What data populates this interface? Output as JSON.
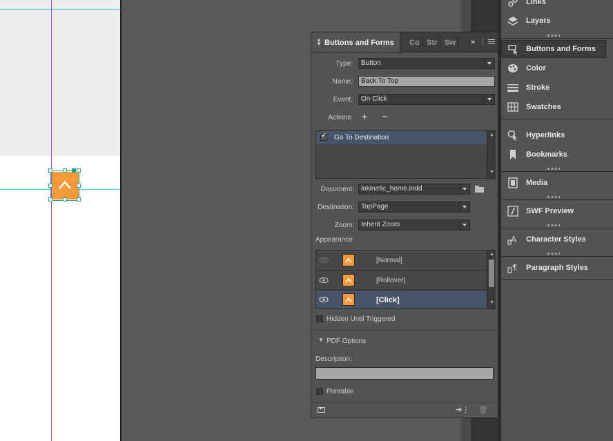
{
  "panel": {
    "tabs": {
      "active": "Buttons and Forms",
      "others": [
        "Co",
        "Str",
        "Sw"
      ]
    },
    "type": {
      "label": "Type:",
      "value": "Button"
    },
    "name": {
      "label": "Name:",
      "value": "Back To Top"
    },
    "event": {
      "label": "Event:",
      "value": "On Click"
    },
    "actions": {
      "label": "Actions:",
      "add": "+",
      "remove": "−",
      "items": [
        {
          "label": "Go To Destination",
          "checked": true
        }
      ]
    },
    "document": {
      "label": "Document:",
      "value": "iokinetic_home.indd"
    },
    "destination": {
      "label": "Destination:",
      "value": "TopPage"
    },
    "zoom": {
      "label": "Zoom:",
      "value": "Inherit Zoom"
    },
    "appearance": {
      "heading": "Appearance",
      "states": [
        {
          "label": "[Normal]",
          "selected": false
        },
        {
          "label": "[Rollover]",
          "selected": false
        },
        {
          "label": "[Click]",
          "selected": true
        }
      ]
    },
    "hidden_until_triggered": {
      "label": "Hidden Until Triggered",
      "checked": false
    },
    "pdf_options": {
      "heading": "PDF Options",
      "description_label": "Description:",
      "description_value": "",
      "printable_label": "Printable",
      "printable_checked": false
    }
  },
  "dock": {
    "items": [
      {
        "label": "Links",
        "icon": "links-icon"
      },
      {
        "label": "Layers",
        "icon": "layers-icon"
      },
      {
        "label": "Buttons and Forms",
        "icon": "buttons-forms-icon",
        "active": true
      },
      {
        "label": "Color",
        "icon": "color-palette-icon"
      },
      {
        "label": "Stroke",
        "icon": "stroke-icon"
      },
      {
        "label": "Swatches",
        "icon": "swatches-icon"
      },
      {
        "label": "Hyperlinks",
        "icon": "hyperlinks-icon"
      },
      {
        "label": "Bookmarks",
        "icon": "bookmark-icon"
      },
      {
        "label": "Media",
        "icon": "media-icon"
      },
      {
        "label": "SWF Preview",
        "icon": "swf-preview-icon"
      },
      {
        "label": "Character Styles",
        "icon": "character-styles-icon"
      },
      {
        "label": "Paragraph Styles",
        "icon": "paragraph-styles-icon"
      }
    ]
  },
  "colors": {
    "accent_orange": "#f59a3b",
    "guide_cyan": "#4ad3d3",
    "guide_purple": "#a34fd0",
    "selection_blue": "#475369"
  }
}
